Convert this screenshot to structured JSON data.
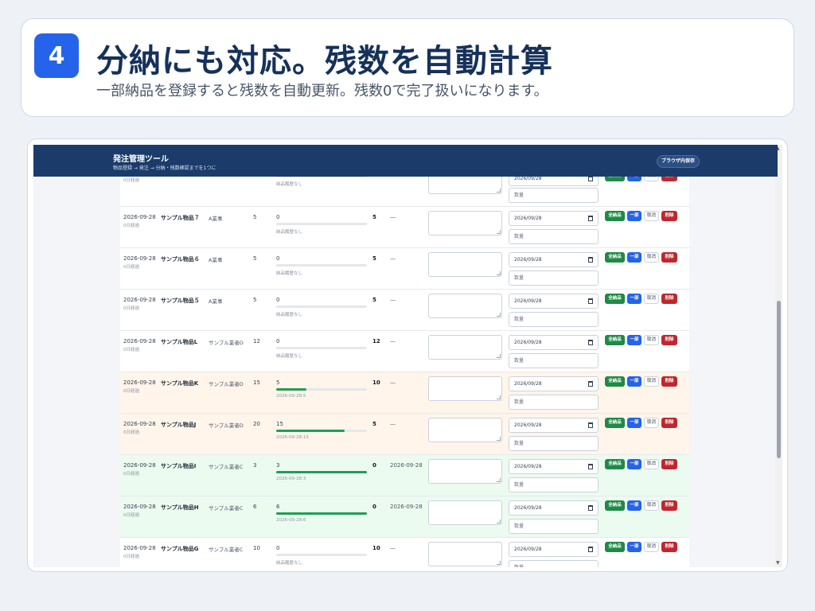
{
  "headline": {
    "step": "4",
    "title": "分納にも対応。残数を自動計算",
    "subtitle": "一部納品を登録すると残数を自動更新。残数0で完了扱いになります。"
  },
  "app": {
    "title": "発注管理ツール",
    "subtitle": "物品登録 → 発注 → 分納・残数確認までを1つに",
    "save_label": "ブラウザ内保存"
  },
  "buttons": {
    "full": "全納品",
    "partial": "一部",
    "cancel": "取消",
    "delete": "削除"
  },
  "qty_placeholder": "数量",
  "rows": [
    {
      "date": "",
      "elapsed": "0日経過",
      "item": "",
      "vendor": "",
      "qty": "",
      "delivered": "",
      "progress": 0,
      "history": "納品履歴なし",
      "remaining": "",
      "completed": "",
      "input_date": "2026/09/28",
      "state": "normal",
      "first": true
    },
    {
      "date": "2026-09-28",
      "elapsed": "0日経過",
      "item": "サンプル物品７",
      "vendor": "A業事",
      "qty": "5",
      "delivered": "0",
      "progress": 0,
      "history": "納品履歴なし",
      "remaining": "5",
      "completed": "—",
      "input_date": "2026/09/28",
      "state": "normal"
    },
    {
      "date": "2026-09-28",
      "elapsed": "0日経過",
      "item": "サンプル物品６",
      "vendor": "A業事",
      "qty": "5",
      "delivered": "0",
      "progress": 0,
      "history": "納品履歴なし",
      "remaining": "5",
      "completed": "—",
      "input_date": "2026/09/28",
      "state": "normal"
    },
    {
      "date": "2026-09-28",
      "elapsed": "0日経過",
      "item": "サンプル物品５",
      "vendor": "A業事",
      "qty": "5",
      "delivered": "0",
      "progress": 0,
      "history": "納品履歴なし",
      "remaining": "5",
      "completed": "—",
      "input_date": "2026/09/28",
      "state": "normal"
    },
    {
      "date": "2026-09-28",
      "elapsed": "0日経過",
      "item": "サンプル物品L",
      "vendor": "サンプル業者D",
      "qty": "12",
      "delivered": "0",
      "progress": 0,
      "history": "納品履歴なし",
      "remaining": "12",
      "completed": "—",
      "input_date": "2026/09/28",
      "state": "normal"
    },
    {
      "date": "2026-09-28",
      "elapsed": "0日経過",
      "item": "サンプル物品K",
      "vendor": "サンプル業者D",
      "qty": "15",
      "delivered": "5",
      "progress": 0.333,
      "history": "2026-09-28:5",
      "remaining": "10",
      "completed": "—",
      "input_date": "2026/09/28",
      "state": "partial"
    },
    {
      "date": "2026-09-28",
      "elapsed": "0日経過",
      "item": "サンプル物品J",
      "vendor": "サンプル業者D",
      "qty": "20",
      "delivered": "15",
      "progress": 0.75,
      "history": "2026-09-28:15",
      "remaining": "5",
      "completed": "—",
      "input_date": "2026/09/28",
      "state": "partial"
    },
    {
      "date": "2026-09-28",
      "elapsed": "0日経過",
      "item": "サンプル物品I",
      "vendor": "サンプル業者C",
      "qty": "3",
      "delivered": "3",
      "progress": 1,
      "history": "2026-09-28:3",
      "remaining": "0",
      "completed": "2026-09-28",
      "input_date": "2026/09/28",
      "state": "done"
    },
    {
      "date": "2026-09-28",
      "elapsed": "0日経過",
      "item": "サンプル物品H",
      "vendor": "サンプル業者C",
      "qty": "6",
      "delivered": "6",
      "progress": 1,
      "history": "2026-09-28:6",
      "remaining": "0",
      "completed": "2026-09-28",
      "input_date": "2026/09/28",
      "state": "done"
    },
    {
      "date": "2026-09-28",
      "elapsed": "0日経過",
      "item": "サンプル物品G",
      "vendor": "サンプル業者C",
      "qty": "10",
      "delivered": "0",
      "progress": 0,
      "history": "納品履歴なし",
      "remaining": "10",
      "completed": "—",
      "input_date": "2026/09/28",
      "state": "normal"
    }
  ]
}
